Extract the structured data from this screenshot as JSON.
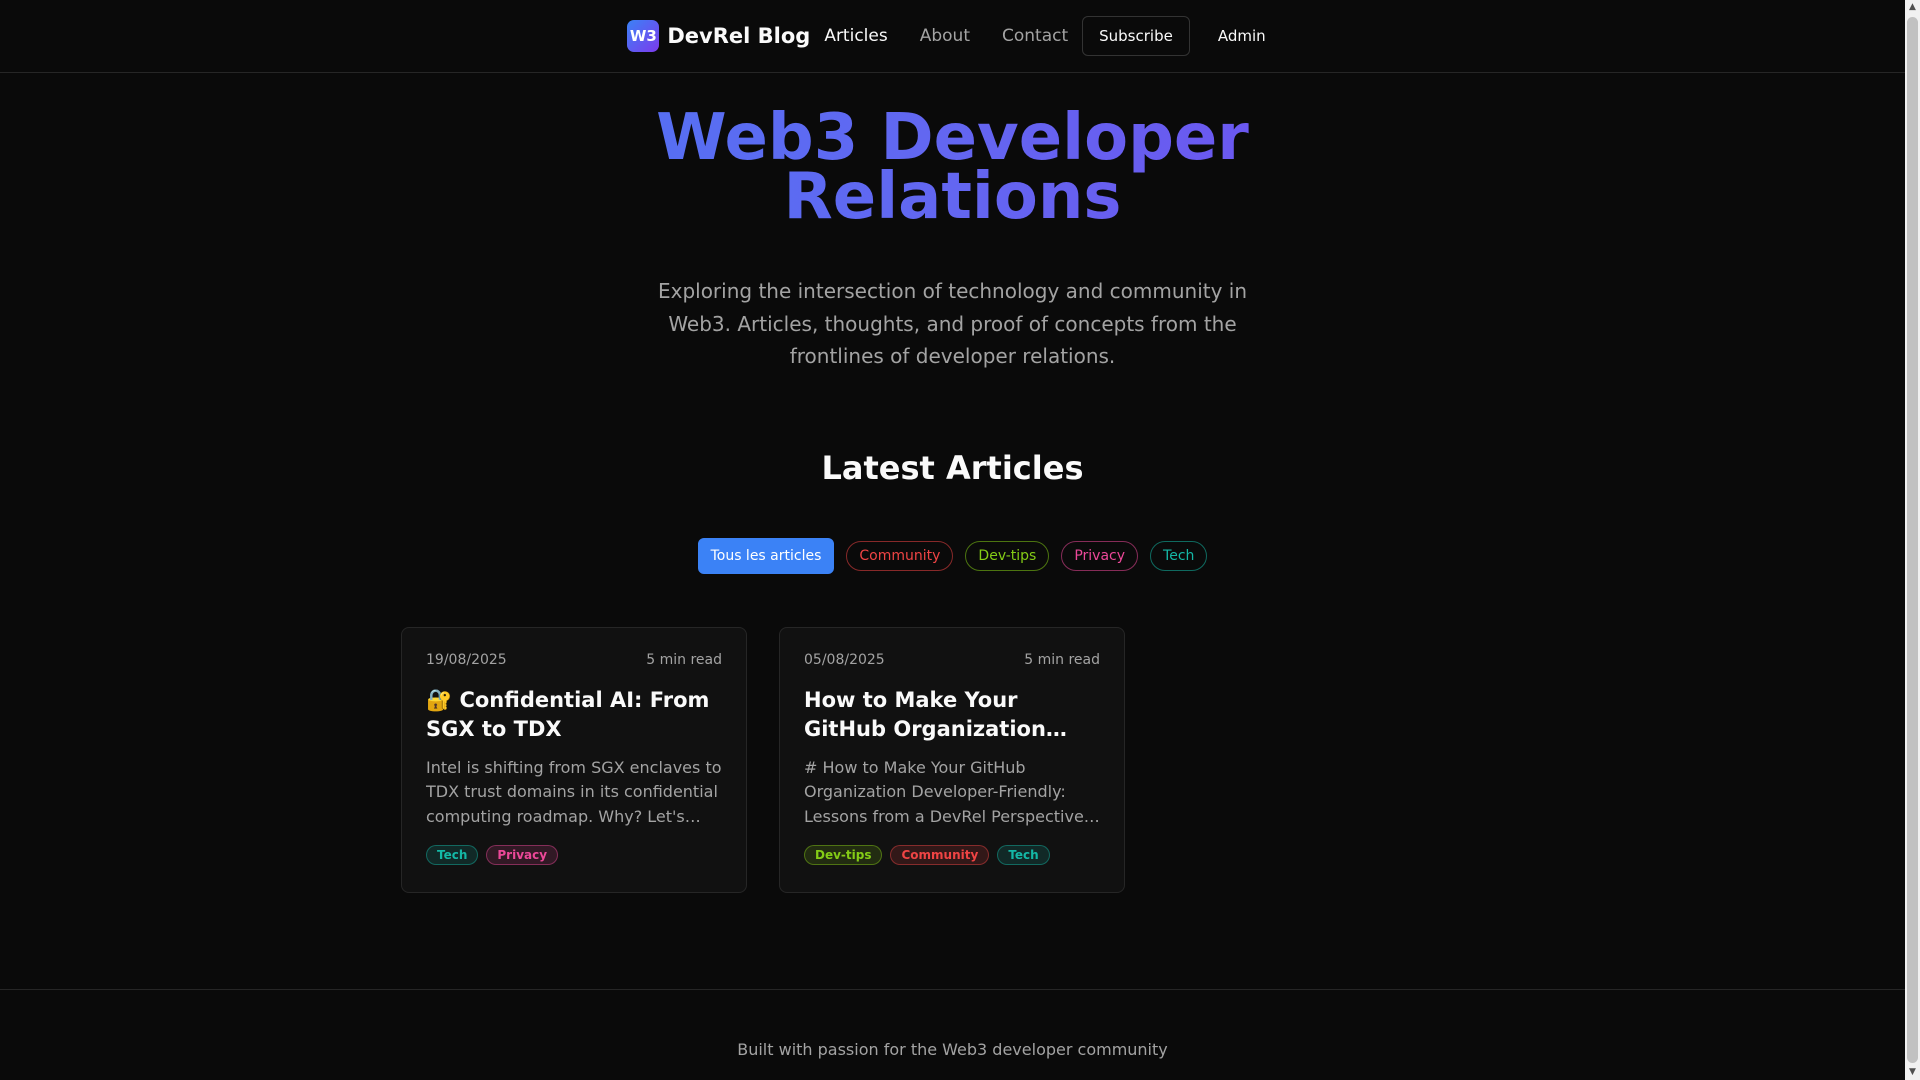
{
  "header": {
    "logo_text": "W3",
    "brand": "DevRel Blog",
    "nav": [
      "Articles",
      "About",
      "Contact"
    ],
    "subscribe": "Subscribe",
    "admin": "Admin"
  },
  "hero": {
    "title_line1": "Web3 Developer",
    "title_line2": "Relations",
    "subtitle": "Exploring the intersection of technology and community in Web3. Articles, thoughts, and proof of concepts from the frontlines of developer relations."
  },
  "latest": {
    "title": "Latest Articles",
    "filters": [
      {
        "label": "Tous les articles",
        "color": "#3b82f6"
      },
      {
        "label": "Community",
        "color": "#ef4444"
      },
      {
        "label": "Dev-tips",
        "color": "#84cc16"
      },
      {
        "label": "Privacy",
        "color": "#ec4899"
      },
      {
        "label": "Tech",
        "color": "#14b8a6"
      }
    ]
  },
  "articles": [
    {
      "date": "19/08/2025",
      "read_time": "5 min read",
      "title": "🔐 Confidential AI: From SGX to TDX",
      "excerpt": "Intel is shifting from SGX enclaves to TDX trust domains in its confidential computing roadmap. Why? Let's explore the reasons behind this change.",
      "tags": [
        {
          "label": "Tech",
          "color": "#14b8a6"
        },
        {
          "label": "Privacy",
          "color": "#ec4899"
        }
      ]
    },
    {
      "date": "05/08/2025",
      "read_time": "5 min read",
      "title": "How to Make Your GitHub Organization Developer-Friendly",
      "excerpt": "# How to Make Your GitHub Organization Developer-Friendly: Lessons from a DevRel Perspective and practical tips for maintainers.",
      "tags": [
        {
          "label": "Dev-tips",
          "color": "#84cc16"
        },
        {
          "label": "Community",
          "color": "#ef4444"
        },
        {
          "label": "Tech",
          "color": "#14b8a6"
        }
      ]
    }
  ],
  "footer": {
    "text": "Built with passion for the Web3 developer community"
  }
}
